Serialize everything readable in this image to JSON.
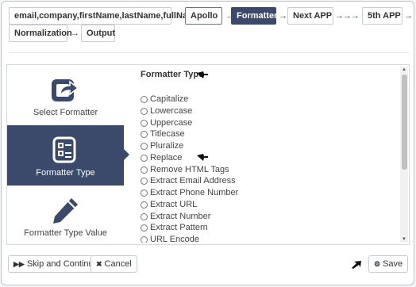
{
  "pipeline": {
    "nodes": [
      {
        "label": "email,company,firstName,lastName,fullName"
      },
      {
        "label": "Apollo"
      },
      {
        "label": "Formatter",
        "active": true
      },
      {
        "label": "Next APP"
      },
      {
        "label": "5th APP"
      },
      {
        "label": "Normalization"
      },
      {
        "label": "Output"
      }
    ],
    "arrow": "→"
  },
  "steps": [
    {
      "label": "Select Formatter",
      "icon": "share-icon"
    },
    {
      "label": "Formatter Type",
      "icon": "document-list-icon",
      "active": true
    },
    {
      "label": "Formatter Type Value",
      "icon": "pencil-icon"
    }
  ],
  "formatter": {
    "title": "Formatter Type",
    "options": [
      "Capitalize",
      "Lowercase",
      "Uppercase",
      "Titlecase",
      "Pluralize",
      "Replace",
      "Remove HTML Tags",
      "Extract Email Address",
      "Extract Phone Number",
      "Extract URL",
      "Extract Number",
      "Extract Pattern",
      "URL Encode"
    ]
  },
  "footer": {
    "skip_label": "Skip and Continue",
    "cancel_label": "Cancel",
    "save_label": "Save"
  },
  "colors": {
    "accent": "#3b4a6b",
    "border": "#c9ccd0"
  }
}
